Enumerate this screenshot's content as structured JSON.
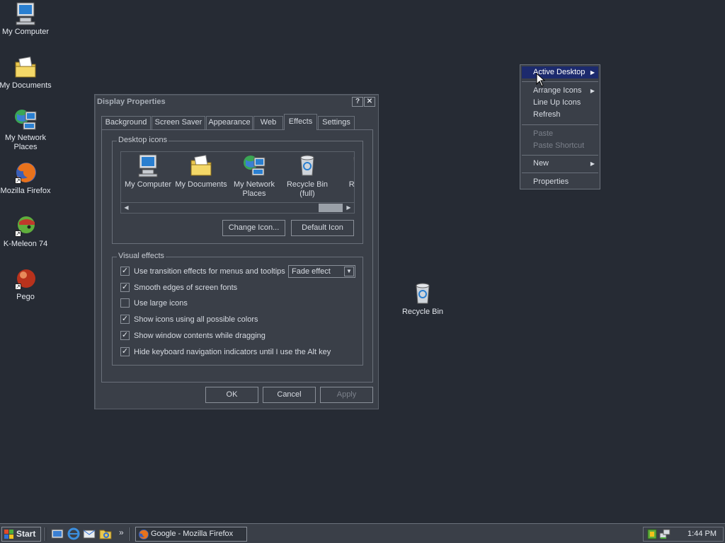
{
  "desktop": {
    "icons": [
      {
        "label": "My Computer"
      },
      {
        "label": "My Documents"
      },
      {
        "label": "My Network Places"
      },
      {
        "label": "Mozilla Firefox"
      },
      {
        "label": "K-Meleon 74"
      },
      {
        "label": "Pego"
      },
      {
        "label": "Recycle Bin"
      }
    ]
  },
  "dialog": {
    "title": "Display Properties",
    "help_glyph": "?",
    "close_glyph": "✕",
    "tabs": [
      {
        "label": "Background"
      },
      {
        "label": "Screen Saver"
      },
      {
        "label": "Appearance"
      },
      {
        "label": "Web"
      },
      {
        "label": "Effects",
        "active": true
      },
      {
        "label": "Settings"
      }
    ],
    "desktop_icons_group": {
      "title": "Desktop icons",
      "items": [
        {
          "label": "My Computer"
        },
        {
          "label": "My Documents"
        },
        {
          "label": "My Network Places"
        },
        {
          "label": "Recycle Bin (full)"
        },
        {
          "label": "Rec (e"
        }
      ],
      "change_icon_label": "Change Icon...",
      "default_icon_label": "Default Icon"
    },
    "visual_effects_group": {
      "title": "Visual effects",
      "options": [
        {
          "label": "Use transition effects for menus and tooltips",
          "checked": true
        },
        {
          "label": "Smooth edges of screen fonts",
          "checked": true
        },
        {
          "label": "Use large icons",
          "checked": false
        },
        {
          "label": "Show icons using all possible colors",
          "checked": true
        },
        {
          "label": "Show window contents while dragging",
          "checked": true
        },
        {
          "label": "Hide keyboard navigation indicators until I use the Alt key",
          "checked": true
        }
      ],
      "transition_effect_value": "Fade effect"
    },
    "ok_label": "OK",
    "cancel_label": "Cancel",
    "apply_label": "Apply"
  },
  "context_menu": {
    "items": [
      {
        "label": "Active Desktop",
        "submenu": true,
        "highlighted": true
      },
      {
        "label": "Arrange Icons",
        "submenu": true
      },
      {
        "label": "Line Up Icons"
      },
      {
        "label": "Refresh"
      },
      {
        "label": "Paste",
        "disabled": true
      },
      {
        "label": "Paste Shortcut",
        "disabled": true
      },
      {
        "label": "New",
        "submenu": true
      },
      {
        "label": "Properties"
      }
    ]
  },
  "taskbar": {
    "start_label": "Start",
    "overflow_glyph": "»",
    "task_label": "Google - Mozilla Firefox",
    "clock": "1:44 PM"
  },
  "colors": {
    "desktop_bg": "#262b34",
    "window_bg": "#3a3f48",
    "menu_highlight": "#1c2a6d"
  }
}
